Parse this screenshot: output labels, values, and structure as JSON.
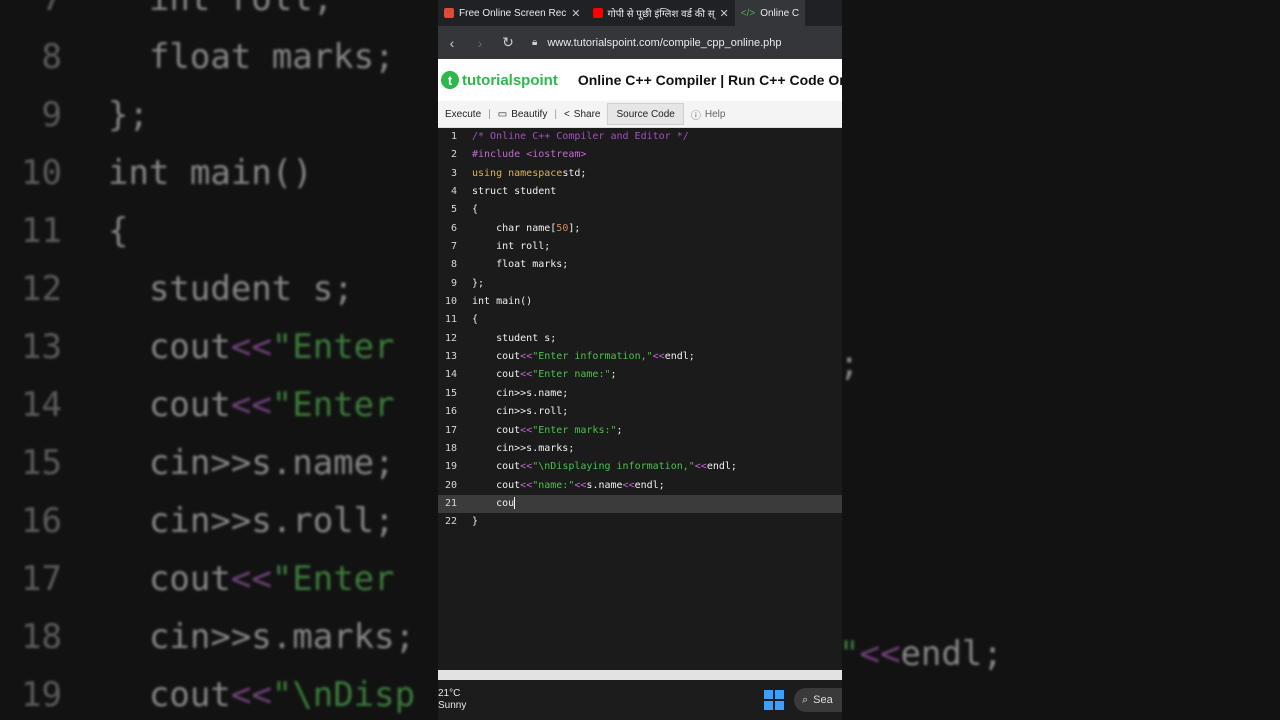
{
  "background_code": {
    "left": [
      {
        "ln": "7",
        "parts": [
          [
            "k",
            "int roll;"
          ]
        ]
      },
      {
        "ln": "8",
        "parts": [
          [
            "k",
            "float marks;"
          ]
        ]
      },
      {
        "ln": "9",
        "parts": [
          [
            "k",
            "};"
          ]
        ]
      },
      {
        "ln": "10",
        "parts": [
          [
            "k",
            "int main()"
          ]
        ]
      },
      {
        "ln": "11",
        "parts": [
          [
            "k",
            "{"
          ]
        ]
      },
      {
        "ln": "12",
        "parts": [
          [
            "k",
            "student s;"
          ]
        ]
      },
      {
        "ln": "13",
        "parts": [
          [
            "k",
            "cout"
          ],
          [
            "o",
            "<<"
          ],
          [
            "s",
            "\"Enter"
          ]
        ]
      },
      {
        "ln": "14",
        "parts": [
          [
            "k",
            "cout"
          ],
          [
            "o",
            "<<"
          ],
          [
            "s",
            "\"Enter"
          ]
        ]
      },
      {
        "ln": "15",
        "parts": [
          [
            "k",
            "cin>>s.name;"
          ]
        ]
      },
      {
        "ln": "16",
        "parts": [
          [
            "k",
            "cin>>s.roll;"
          ]
        ]
      },
      {
        "ln": "17",
        "parts": [
          [
            "k",
            "cout"
          ],
          [
            "o",
            "<<"
          ],
          [
            "s",
            "\"Enter"
          ]
        ]
      },
      {
        "ln": "18",
        "parts": [
          [
            "k",
            "cin>>s.marks;"
          ]
        ]
      },
      {
        "ln": "19",
        "parts": [
          [
            "k",
            "cout"
          ],
          [
            "o",
            "<<"
          ],
          [
            "s",
            "\"\\nDisp"
          ]
        ]
      }
    ],
    "right": [
      {
        "parts": [
          [
            "k",
            ";"
          ]
        ]
      },
      {
        "parts": [
          [
            "s",
            "\""
          ],
          [
            "o",
            "<<"
          ],
          [
            "k",
            "endl;"
          ]
        ]
      }
    ]
  },
  "browser": {
    "tabs": [
      {
        "label": "Free Online Screen Rec",
        "color": "#e04a3a"
      },
      {
        "label": "गोपी से पूछी इंग्लिश वर्ड की स्",
        "color": "#ff0000"
      },
      {
        "label": "Online C",
        "color": "#4caf50"
      }
    ],
    "url": "www.tutorialspoint.com/compile_cpp_online.php"
  },
  "site": {
    "logo_text": "tutorialspoint",
    "title": "Online C++ Compiler | Run C++ Code Onlin"
  },
  "toolbar": {
    "execute": "Execute",
    "beautify": "Beautify",
    "share": "Share",
    "source_code": "Source Code",
    "help": "Help"
  },
  "editor": {
    "active_line": 21,
    "lines": [
      [
        [
          "c-cm",
          "/* Online C++ Compiler and Editor */"
        ]
      ],
      [
        [
          "c-pp",
          "#include "
        ],
        [
          "c-op",
          "<iostream>"
        ]
      ],
      [
        [
          "c-kw",
          "using namespace"
        ],
        [
          "",
          "std;"
        ]
      ],
      [
        [
          "",
          "struct student"
        ]
      ],
      [
        [
          "",
          "{"
        ]
      ],
      [
        [
          "",
          "    char name["
        ],
        [
          "c-num",
          "50"
        ],
        [
          "",
          "];"
        ]
      ],
      [
        [
          "",
          "    int roll;"
        ]
      ],
      [
        [
          "",
          "    float marks;"
        ]
      ],
      [
        [
          "",
          "};"
        ]
      ],
      [
        [
          "",
          "int main()"
        ]
      ],
      [
        [
          "",
          "{"
        ]
      ],
      [
        [
          "",
          "    student s;"
        ]
      ],
      [
        [
          "",
          "    cout"
        ],
        [
          "c-op",
          "<<"
        ],
        [
          "c-st",
          "\"Enter information,\""
        ],
        [
          "c-op",
          "<<"
        ],
        [
          "",
          "endl;"
        ]
      ],
      [
        [
          "",
          "    cout"
        ],
        [
          "c-op",
          "<<"
        ],
        [
          "c-st",
          "\"Enter name:\""
        ],
        [
          "",
          ";"
        ]
      ],
      [
        [
          "",
          "    cin>>s.name;"
        ]
      ],
      [
        [
          "",
          "    cin>>s.roll;"
        ]
      ],
      [
        [
          "",
          "    cout"
        ],
        [
          "c-op",
          "<<"
        ],
        [
          "c-st",
          "\"Enter marks:\""
        ],
        [
          "",
          ";"
        ]
      ],
      [
        [
          "",
          "    cin>>s.marks;"
        ]
      ],
      [
        [
          "",
          "    cout"
        ],
        [
          "c-op",
          "<<"
        ],
        [
          "c-st",
          "\"\\nDisplaying information,\""
        ],
        [
          "c-op",
          "<<"
        ],
        [
          "",
          "endl;"
        ]
      ],
      [
        [
          "",
          "    cout"
        ],
        [
          "c-op",
          "<<"
        ],
        [
          "c-st",
          "\"name:\""
        ],
        [
          "c-op",
          "<<"
        ],
        [
          "",
          "s.name"
        ],
        [
          "c-op",
          "<<"
        ],
        [
          "",
          "endl;"
        ]
      ],
      [
        [
          "",
          "    cou"
        ]
      ],
      [
        [
          "",
          "}"
        ]
      ]
    ]
  },
  "taskbar": {
    "temp": "21°C",
    "condition": "Sunny",
    "search": "Sea"
  }
}
